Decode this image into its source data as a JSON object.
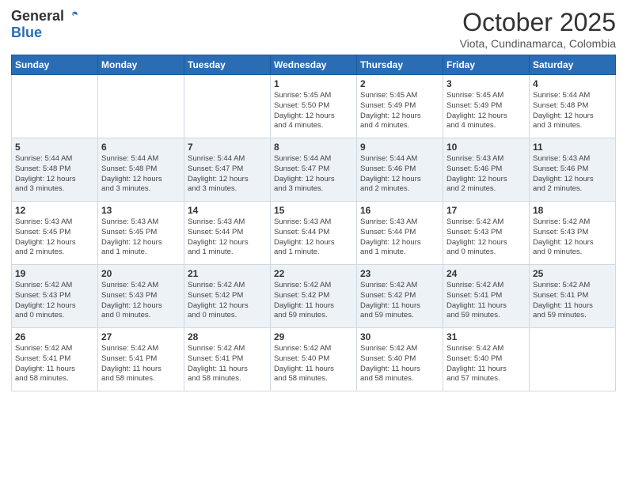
{
  "header": {
    "logo_general": "General",
    "logo_blue": "Blue",
    "month_title": "October 2025",
    "location": "Viota, Cundinamarca, Colombia"
  },
  "weekdays": [
    "Sunday",
    "Monday",
    "Tuesday",
    "Wednesday",
    "Thursday",
    "Friday",
    "Saturday"
  ],
  "weeks": [
    {
      "group": 1,
      "days": [
        {
          "num": "",
          "info": ""
        },
        {
          "num": "",
          "info": ""
        },
        {
          "num": "",
          "info": ""
        },
        {
          "num": "1",
          "info": "Sunrise: 5:45 AM\nSunset: 5:50 PM\nDaylight: 12 hours\nand 4 minutes."
        },
        {
          "num": "2",
          "info": "Sunrise: 5:45 AM\nSunset: 5:49 PM\nDaylight: 12 hours\nand 4 minutes."
        },
        {
          "num": "3",
          "info": "Sunrise: 5:45 AM\nSunset: 5:49 PM\nDaylight: 12 hours\nand 4 minutes."
        },
        {
          "num": "4",
          "info": "Sunrise: 5:44 AM\nSunset: 5:48 PM\nDaylight: 12 hours\nand 3 minutes."
        }
      ]
    },
    {
      "group": 2,
      "days": [
        {
          "num": "5",
          "info": "Sunrise: 5:44 AM\nSunset: 5:48 PM\nDaylight: 12 hours\nand 3 minutes."
        },
        {
          "num": "6",
          "info": "Sunrise: 5:44 AM\nSunset: 5:48 PM\nDaylight: 12 hours\nand 3 minutes."
        },
        {
          "num": "7",
          "info": "Sunrise: 5:44 AM\nSunset: 5:47 PM\nDaylight: 12 hours\nand 3 minutes."
        },
        {
          "num": "8",
          "info": "Sunrise: 5:44 AM\nSunset: 5:47 PM\nDaylight: 12 hours\nand 3 minutes."
        },
        {
          "num": "9",
          "info": "Sunrise: 5:44 AM\nSunset: 5:46 PM\nDaylight: 12 hours\nand 2 minutes."
        },
        {
          "num": "10",
          "info": "Sunrise: 5:43 AM\nSunset: 5:46 PM\nDaylight: 12 hours\nand 2 minutes."
        },
        {
          "num": "11",
          "info": "Sunrise: 5:43 AM\nSunset: 5:46 PM\nDaylight: 12 hours\nand 2 minutes."
        }
      ]
    },
    {
      "group": 3,
      "days": [
        {
          "num": "12",
          "info": "Sunrise: 5:43 AM\nSunset: 5:45 PM\nDaylight: 12 hours\nand 2 minutes."
        },
        {
          "num": "13",
          "info": "Sunrise: 5:43 AM\nSunset: 5:45 PM\nDaylight: 12 hours\nand 1 minute."
        },
        {
          "num": "14",
          "info": "Sunrise: 5:43 AM\nSunset: 5:44 PM\nDaylight: 12 hours\nand 1 minute."
        },
        {
          "num": "15",
          "info": "Sunrise: 5:43 AM\nSunset: 5:44 PM\nDaylight: 12 hours\nand 1 minute."
        },
        {
          "num": "16",
          "info": "Sunrise: 5:43 AM\nSunset: 5:44 PM\nDaylight: 12 hours\nand 1 minute."
        },
        {
          "num": "17",
          "info": "Sunrise: 5:42 AM\nSunset: 5:43 PM\nDaylight: 12 hours\nand 0 minutes."
        },
        {
          "num": "18",
          "info": "Sunrise: 5:42 AM\nSunset: 5:43 PM\nDaylight: 12 hours\nand 0 minutes."
        }
      ]
    },
    {
      "group": 4,
      "days": [
        {
          "num": "19",
          "info": "Sunrise: 5:42 AM\nSunset: 5:43 PM\nDaylight: 12 hours\nand 0 minutes."
        },
        {
          "num": "20",
          "info": "Sunrise: 5:42 AM\nSunset: 5:43 PM\nDaylight: 12 hours\nand 0 minutes."
        },
        {
          "num": "21",
          "info": "Sunrise: 5:42 AM\nSunset: 5:42 PM\nDaylight: 12 hours\nand 0 minutes."
        },
        {
          "num": "22",
          "info": "Sunrise: 5:42 AM\nSunset: 5:42 PM\nDaylight: 11 hours\nand 59 minutes."
        },
        {
          "num": "23",
          "info": "Sunrise: 5:42 AM\nSunset: 5:42 PM\nDaylight: 11 hours\nand 59 minutes."
        },
        {
          "num": "24",
          "info": "Sunrise: 5:42 AM\nSunset: 5:41 PM\nDaylight: 11 hours\nand 59 minutes."
        },
        {
          "num": "25",
          "info": "Sunrise: 5:42 AM\nSunset: 5:41 PM\nDaylight: 11 hours\nand 59 minutes."
        }
      ]
    },
    {
      "group": 5,
      "days": [
        {
          "num": "26",
          "info": "Sunrise: 5:42 AM\nSunset: 5:41 PM\nDaylight: 11 hours\nand 58 minutes."
        },
        {
          "num": "27",
          "info": "Sunrise: 5:42 AM\nSunset: 5:41 PM\nDaylight: 11 hours\nand 58 minutes."
        },
        {
          "num": "28",
          "info": "Sunrise: 5:42 AM\nSunset: 5:41 PM\nDaylight: 11 hours\nand 58 minutes."
        },
        {
          "num": "29",
          "info": "Sunrise: 5:42 AM\nSunset: 5:40 PM\nDaylight: 11 hours\nand 58 minutes."
        },
        {
          "num": "30",
          "info": "Sunrise: 5:42 AM\nSunset: 5:40 PM\nDaylight: 11 hours\nand 58 minutes."
        },
        {
          "num": "31",
          "info": "Sunrise: 5:42 AM\nSunset: 5:40 PM\nDaylight: 11 hours\nand 57 minutes."
        },
        {
          "num": "",
          "info": ""
        }
      ]
    }
  ]
}
